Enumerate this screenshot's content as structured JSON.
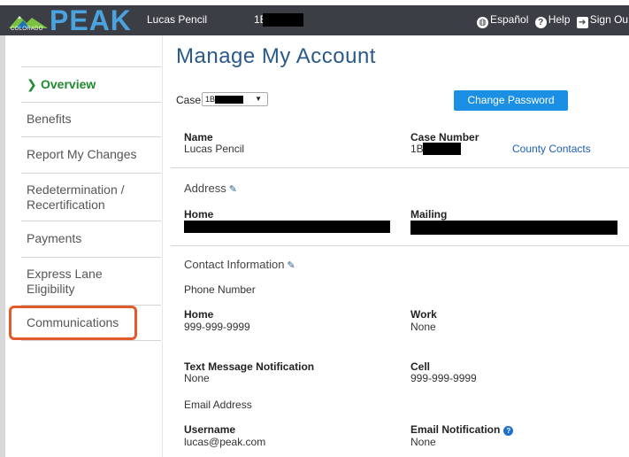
{
  "header": {
    "logo_state": "COLORADO",
    "logo_text": "PEAK",
    "user_name": "Lucas Pencil",
    "case_prefix": "1B",
    "links": {
      "espanol": "Español",
      "help": "Help",
      "sign_out": "Sign Ou"
    }
  },
  "sidebar": {
    "items": [
      {
        "label": "Overview",
        "active": true
      },
      {
        "label": "Benefits"
      },
      {
        "label": "Report My Changes"
      },
      {
        "label": "Redetermination /\nRecertification"
      },
      {
        "label": "Payments"
      },
      {
        "label": "Express Lane\nEligibility"
      },
      {
        "label": "Communications",
        "highlighted": true
      }
    ],
    "line1": {
      "redet": "Redetermination /",
      "recert": "Recertification",
      "express": "Express Lane",
      "elig": "Eligibility"
    }
  },
  "main": {
    "title": "Manage My Account",
    "case_label": "Case:",
    "case_select_prefix": "1B",
    "change_password": "Change Password",
    "name_label": "Name",
    "name_value": "Lucas Pencil",
    "case_number_label": "Case Number",
    "case_number_prefix": "1B",
    "county_contacts": "County Contacts",
    "address_heading": "Address",
    "home_label": "Home",
    "mailing_label": "Mailing",
    "contact_heading": "Contact Information",
    "phone_number": "Phone Number",
    "phone_home_label": "Home",
    "phone_home_value": "999-999-9999",
    "work_label": "Work",
    "work_value": "None",
    "text_notif_label": "Text Message Notification",
    "text_notif_value": "None",
    "cell_label": "Cell",
    "cell_value": "999-999-9999",
    "email_address": "Email Address",
    "username_label": "Username",
    "username_value": "lucas@peak.com",
    "email_notif_label": "Email Notification",
    "email_notif_value": "None"
  },
  "colors": {
    "topbar": "#3b3e44",
    "active_nav": "#1e8a2f",
    "title": "#2a5a8a",
    "button": "#1a8fe3",
    "highlight": "#e05a2a"
  }
}
